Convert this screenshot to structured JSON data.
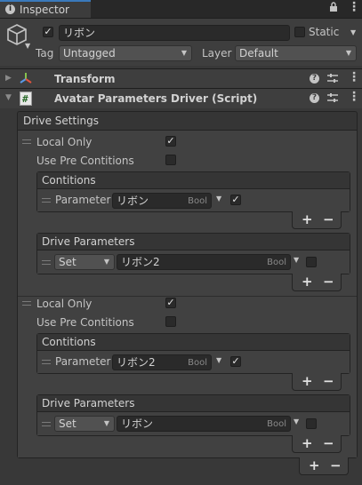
{
  "tab": {
    "label": "Inspector"
  },
  "object": {
    "name": "リボン",
    "static_label": "Static",
    "tag_label": "Tag",
    "tag_value": "Untagged",
    "layer_label": "Layer",
    "layer_value": "Default"
  },
  "components": {
    "transform": {
      "title": "Transform"
    },
    "script": {
      "title": "Avatar Parameters Driver (Script)"
    }
  },
  "drive_settings": {
    "label": "Drive Settings"
  },
  "drivers": [
    {
      "local_only_label": "Local Only",
      "local_only": true,
      "use_pre_label": "Use Pre Contitions",
      "use_pre": false,
      "conditions_header": "Contitions",
      "condition": {
        "label": "Parameter",
        "value": "リボン",
        "type": "Bool",
        "checked": true
      },
      "drive_header": "Drive Parameters",
      "drive": {
        "mode": "Set",
        "value": "リボン2",
        "type": "Bool",
        "checked": false
      }
    },
    {
      "local_only_label": "Local Only",
      "local_only": true,
      "use_pre_label": "Use Pre Contitions",
      "use_pre": false,
      "conditions_header": "Contitions",
      "condition": {
        "label": "Parameter",
        "value": "リボン2",
        "type": "Bool",
        "checked": true
      },
      "drive_header": "Drive Parameters",
      "drive": {
        "mode": "Set",
        "value": "リボン",
        "type": "Bool",
        "checked": false
      }
    }
  ],
  "buttons": {
    "plus": "+",
    "minus": "−"
  },
  "icons": {
    "info": "info-icon",
    "lock": "lock-icon",
    "menu": "menu-icon",
    "cube": "cube-icon",
    "help": "help-icon",
    "presets": "presets-icon",
    "kebab": "kebab-icon",
    "script": "script-icon",
    "transform": "transform-icon",
    "checkmark": "✓"
  },
  "colors": {
    "tab_accent": "#3a79bb",
    "background": "#383838",
    "field": "#2a2a2a"
  }
}
